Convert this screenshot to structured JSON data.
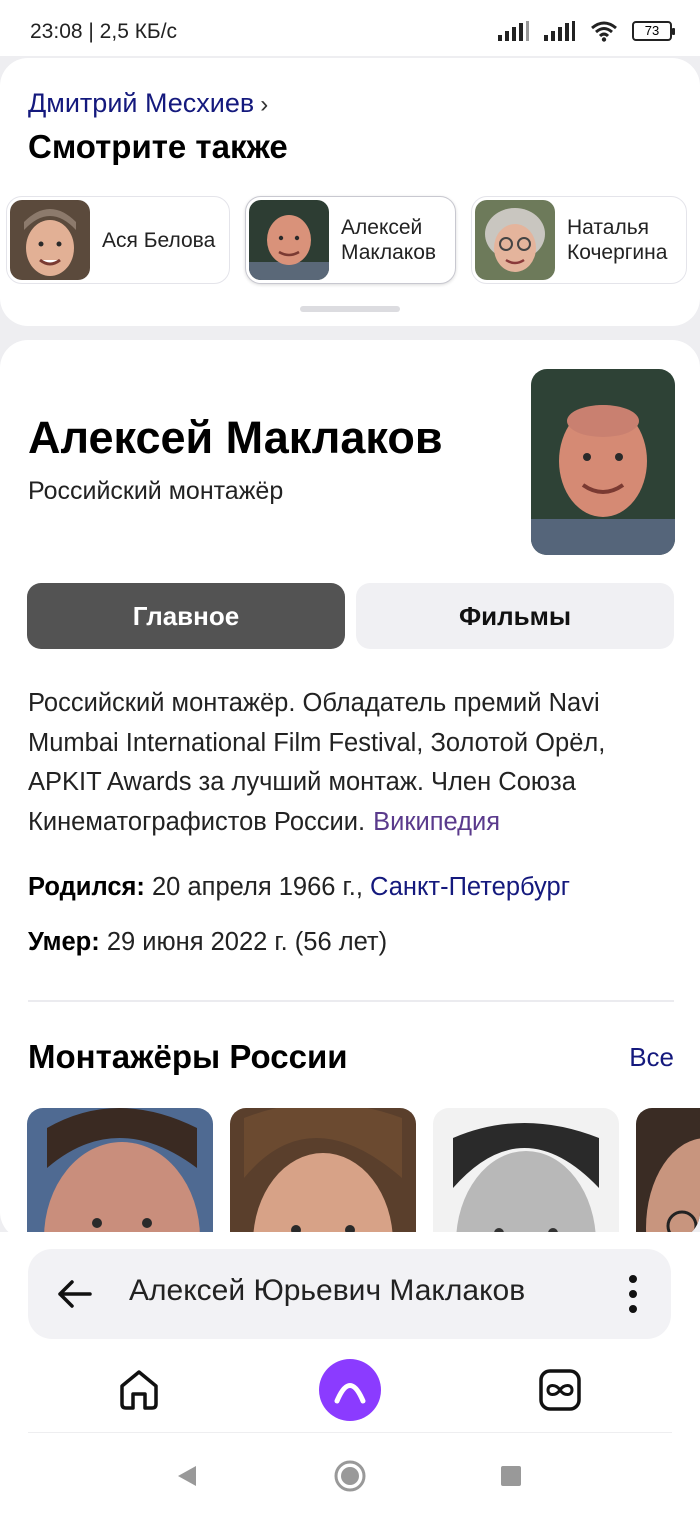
{
  "status_bar": {
    "time_speed": "23:08 | 2,5 КБ/с",
    "battery": "73"
  },
  "see_also": {
    "breadcrumb": "Дмитрий Месхиев",
    "title": "Смотрите также",
    "people": [
      {
        "name": "Ася Белова"
      },
      {
        "name": "Алексей\nМаклаков"
      },
      {
        "name": "Наталья\nКочергина"
      }
    ]
  },
  "entity": {
    "name": "Алексей Маклаков",
    "subtitle": "Российский монтажёр",
    "tabs": [
      "Главное",
      "Фильмы"
    ],
    "description": "Российский монтажёр. Обладатель премий Navi Mumbai International Film Festival, Золотой Орёл, APKIT Awards за лучший монтаж. Член Союза Кинематографистов России.",
    "source": "Википедия",
    "born_label": "Родился:",
    "born_value": "20 апреля 1966 г.,",
    "born_place": "Санкт-Петербург",
    "died_label": "Умер:",
    "died_value": "29 июня 2022 г. (56 лет)"
  },
  "related": {
    "title": "Монтажёры России",
    "all_label": "Все"
  },
  "search": {
    "query": "Алексей Юрьевич Маклаков"
  },
  "nav": {
    "icons": [
      "home-icon",
      "alice-icon",
      "tabs-icon"
    ]
  },
  "colors": {
    "link": "#14197d",
    "accent": "#8b3bff",
    "active_tab": "#535353"
  }
}
